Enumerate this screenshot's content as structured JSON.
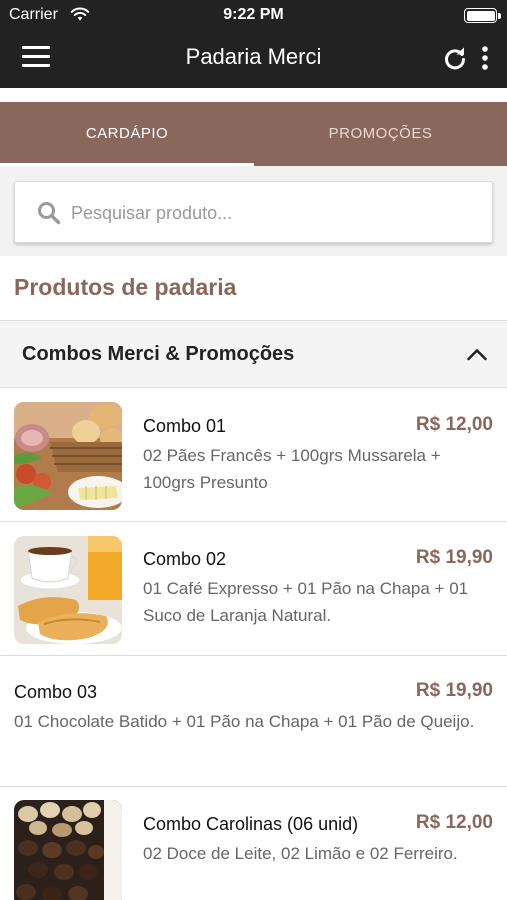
{
  "status_bar": {
    "carrier": "Carrier",
    "time": "9:22 PM"
  },
  "app_bar": {
    "title": "Padaria Merci"
  },
  "tabs": [
    {
      "label": "CARDÁPIO",
      "active": true
    },
    {
      "label": "PROMOÇÕES",
      "active": false
    }
  ],
  "search": {
    "placeholder": "Pesquisar produto...",
    "value": ""
  },
  "section_title": "Produtos de padaria",
  "category": {
    "label": "Combos Merci & Promoções",
    "expanded": true
  },
  "products": [
    {
      "name": "Combo 01",
      "price": "R$ 12,00",
      "description": "02 Pães Francês + 100grs Mussarela + 100grs Presunto"
    },
    {
      "name": "Combo 02",
      "price": "R$ 19,90",
      "description": "01 Café Expresso + 01 Pão na Chapa + 01 Suco de Laranja Natural."
    },
    {
      "name": "Combo 03",
      "price": "R$ 19,90",
      "description": "01 Chocolate Batido + 01 Pão na Chapa + 01 Pão de Queijo."
    },
    {
      "name": "Combo Carolinas (06 unid)",
      "price": "R$ 12,00",
      "description": "02 Doce de Leite, 02 Limão e 02 Ferreiro."
    }
  ],
  "colors": {
    "brand": "#8a675c",
    "app_bar": "#222222"
  },
  "icons": [
    "wifi-icon",
    "battery-icon",
    "menu-icon",
    "refresh-icon",
    "more-vertical-icon",
    "search-icon",
    "chevron-up-icon"
  ]
}
